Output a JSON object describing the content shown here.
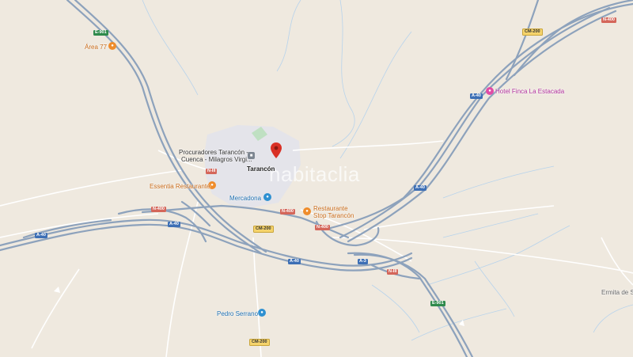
{
  "map": {
    "town": "Tarancón",
    "watermark": "habitaclia",
    "pois": {
      "area77": "Área 77",
      "procuradores_line1": "Procuradores Tarancón -",
      "procuradores_line2": "Cuenca - Milagros Virgi...",
      "essentia": "Essentia Restaurante",
      "mercadona": "Mercadona",
      "restaurante_stop_line1": "Restaurante",
      "restaurante_stop_line2": "Stop Tarancón",
      "hotel": "Hotel Finca La Estacada",
      "pedro_serrano": "Pedro Serrano",
      "ermita": "Ermita de Sa"
    },
    "shields": {
      "e901_top": "E-901",
      "n400_top": "N-400",
      "cm200_top": "CM-200",
      "a40_ne": "A-40",
      "n3_center": "N-III",
      "n400_west": "N-400",
      "a40_west": "A-40",
      "a40_sw": "A-40",
      "n400_mid": "N-400",
      "n400_east": "N-400",
      "cm200_mid": "CM-200",
      "a40_east": "A-40",
      "a40_south": "A-40",
      "a3_south": "A-3",
      "n3_south": "N-III",
      "e901_south": "E-901",
      "cm200_bottom": "CM-200"
    },
    "colors": {
      "background": "#efe9df",
      "highway": "#8ea3bd",
      "highway_edge": "#6f86a3",
      "urban": "#e6e6ec",
      "water": "#a8cbe8",
      "pin": "#d93025"
    }
  }
}
